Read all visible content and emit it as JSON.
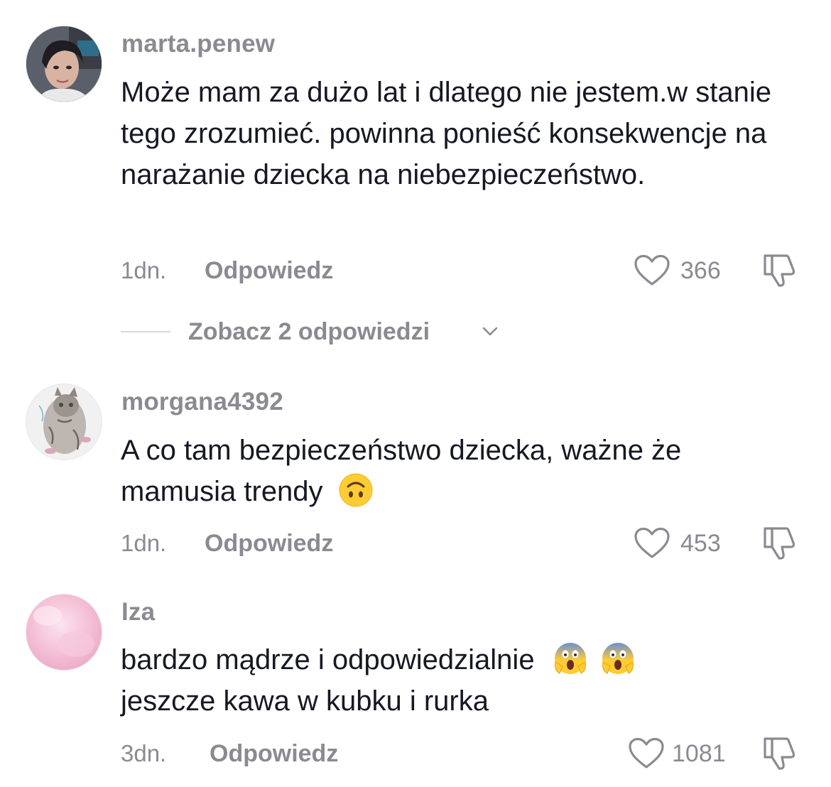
{
  "comments": [
    {
      "username": "marta.penew",
      "text": "Może mam za dużo lat i dlatego nie jestem.w stanie tego zrozumieć. powinna ponieść konsekwencje na narażanie dziecka na niebezpieczeństwo.",
      "time": "1dn.",
      "reply_label": "Odpowiedz",
      "likes": "366",
      "avatar": "woman-photo"
    },
    {
      "username": "morgana4392",
      "text": "A co tam bezpieczeństwo dziecka, ważne że mamusia trendy",
      "emojis": [
        "upside-down-face"
      ],
      "time": "1dn.",
      "reply_label": "Odpowiedz",
      "likes": "453",
      "avatar": "kitten-drawing"
    },
    {
      "username": "Iza",
      "text": "bardzo mądrze i odpowiedzialnie",
      "text_line2": "jeszcze kawa w kubku i rurka",
      "emojis": [
        "screaming-face",
        "screaming-face"
      ],
      "time": "3dn.",
      "reply_label": "Odpowiedz",
      "likes": "1081",
      "avatar": "pink-watercolor"
    }
  ],
  "view_replies": {
    "label": "Zobacz 2 odpowiedzi"
  },
  "colors": {
    "text": "#161823",
    "secondary": "#8a8b91",
    "divider": "#d8d8da",
    "emoji_yellow": "#ffcc33"
  },
  "icons": [
    "heart-outline-icon",
    "thumbs-down-icon",
    "chevron-down-icon"
  ]
}
